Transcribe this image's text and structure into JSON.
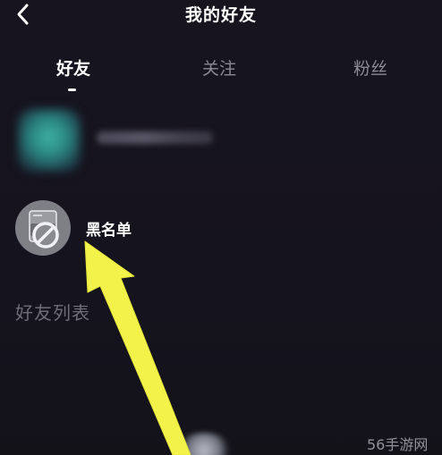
{
  "header": {
    "title": "我的好友",
    "back_icon": "chevron-left-icon"
  },
  "tabs": [
    {
      "label": "好友",
      "active": true
    },
    {
      "label": "关注",
      "active": false
    },
    {
      "label": "粉丝",
      "active": false
    }
  ],
  "list": {
    "blacklist_label": "黑名单",
    "blacklist_icon": "block-icon"
  },
  "section": {
    "friends_list_label": "好友列表"
  },
  "watermark": "56手游网",
  "colors": {
    "background": "#16131f",
    "text_primary": "#ffffff",
    "text_secondary": "#8c8a97",
    "arrow": "#f2f24a"
  }
}
